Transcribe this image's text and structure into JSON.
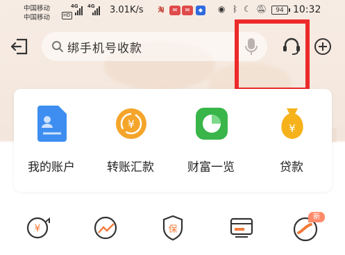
{
  "status_bar": {
    "carrier_1": "中国移动",
    "carrier_2": "中国移动",
    "hd_badge": "HD",
    "signal_1": "4G",
    "signal_2": "4G",
    "net_speed": "3.01K/s",
    "app_icon_1": "淘",
    "battery": "94",
    "time": "10:32"
  },
  "top_bar": {
    "search_placeholder": "绑手机号收款",
    "icons": [
      "back-icon",
      "search-icon",
      "microphone-icon",
      "customer-service-icon",
      "add-icon"
    ]
  },
  "features": [
    {
      "label": "我的账户",
      "icon": "account-icon",
      "color": "#3d8ef0"
    },
    {
      "label": "转账汇款",
      "icon": "transfer-icon",
      "color": "#f4a52a"
    },
    {
      "label": "财富一览",
      "icon": "wealth-icon",
      "color": "#39b54a"
    },
    {
      "label": "贷款",
      "icon": "loan-icon",
      "color": "#f6b21b"
    }
  ],
  "grid": {
    "new_badge": "新",
    "items": [
      {
        "icon": "yuan-circle-icon"
      },
      {
        "icon": "trend-icon"
      },
      {
        "icon": "insurance-icon"
      },
      {
        "icon": "card-icon"
      },
      {
        "icon": "promo-icon"
      }
    ]
  },
  "colors": {
    "highlight": "#ec2a2a",
    "accent_orange": "#f37a3a"
  }
}
